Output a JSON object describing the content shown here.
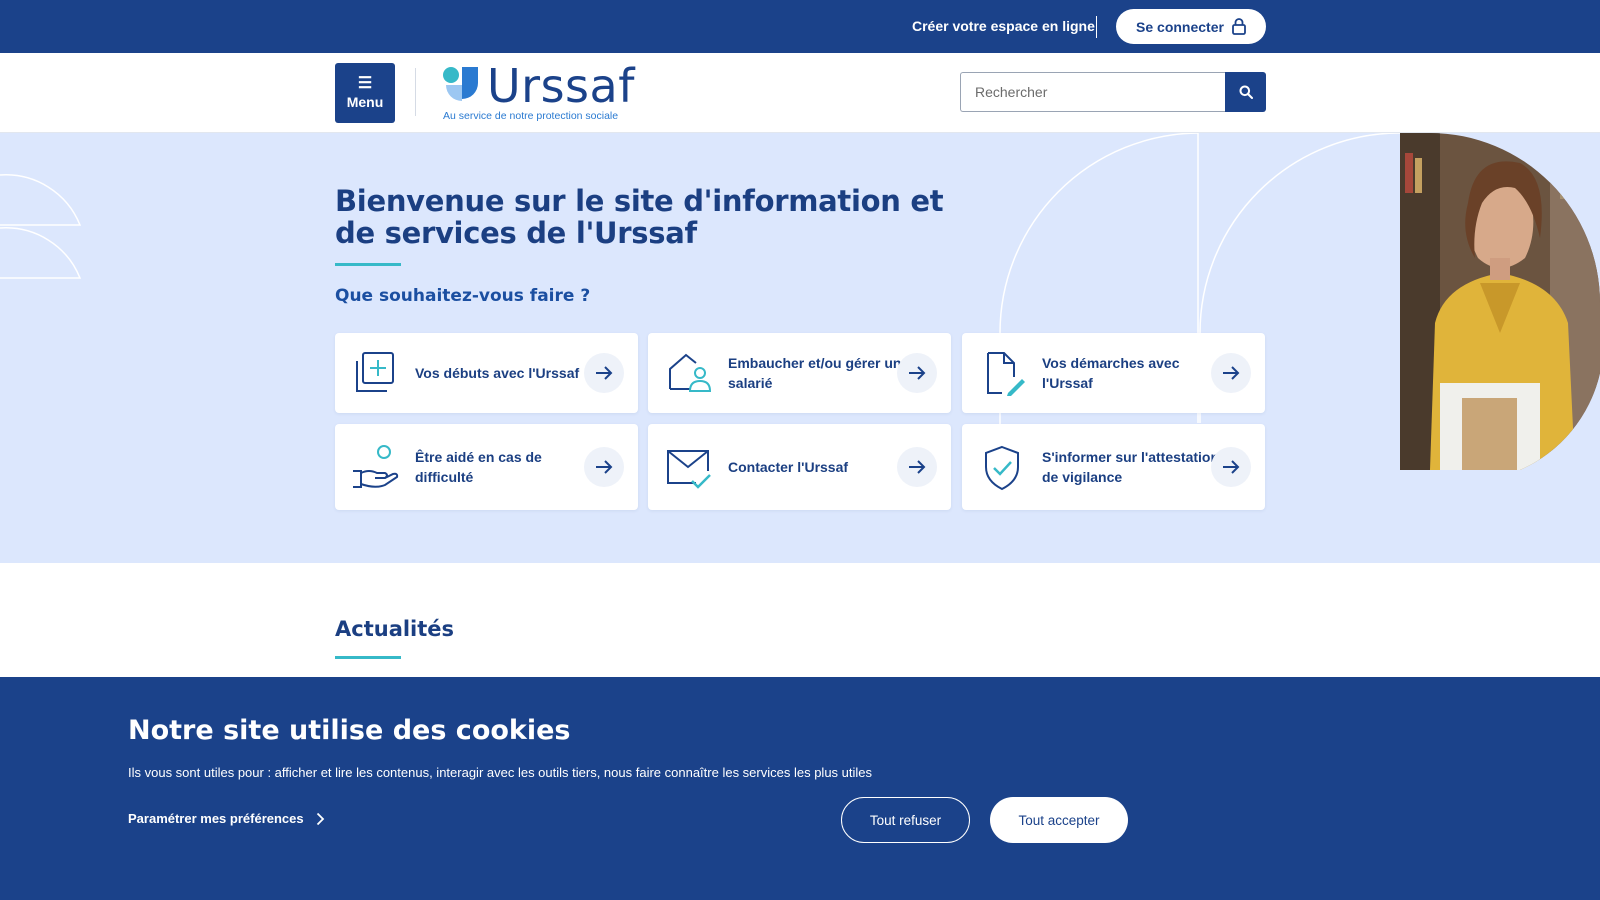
{
  "topbar": {
    "create_label": "Créer votre espace en ligne",
    "login_label": "Se connecter"
  },
  "header": {
    "menu_label": "Menu",
    "logo_text": "Urssaf",
    "logo_tagline": "Au service de notre protection sociale",
    "search_placeholder": "Rechercher"
  },
  "hero": {
    "title": "Bienvenue sur le site d'information et de services de l'Urssaf",
    "subtitle": "Que souhaitez-vous faire ?",
    "cards": [
      {
        "label": "Vos débuts avec l'Urssaf",
        "icon": "add-document-icon"
      },
      {
        "label": "Embaucher et/ou gérer un salarié",
        "icon": "house-person-icon"
      },
      {
        "label": "Vos démarches avec l'Urssaf",
        "icon": "document-pen-icon"
      },
      {
        "label": "Être aidé en cas de difficulté",
        "icon": "helping-hand-icon"
      },
      {
        "label": "Contacter l'Urssaf",
        "icon": "envelope-check-icon"
      },
      {
        "label": "S'informer sur l'attestation de vigilance",
        "icon": "shield-check-icon"
      }
    ]
  },
  "news": {
    "title": "Actualités"
  },
  "cookie": {
    "title": "Notre site utilise des cookies",
    "description": "Ils vous sont utiles pour : afficher et lire les contenus, interagir avec les outils tiers, nous faire connaître les services les plus utiles",
    "preferences_label": "Paramétrer mes préférences",
    "refuse_label": "Tout refuser",
    "accept_label": "Tout accepter"
  },
  "colors": {
    "primary": "#1b428a",
    "accent": "#36b9c8",
    "hero_bg": "#dce7fd"
  }
}
